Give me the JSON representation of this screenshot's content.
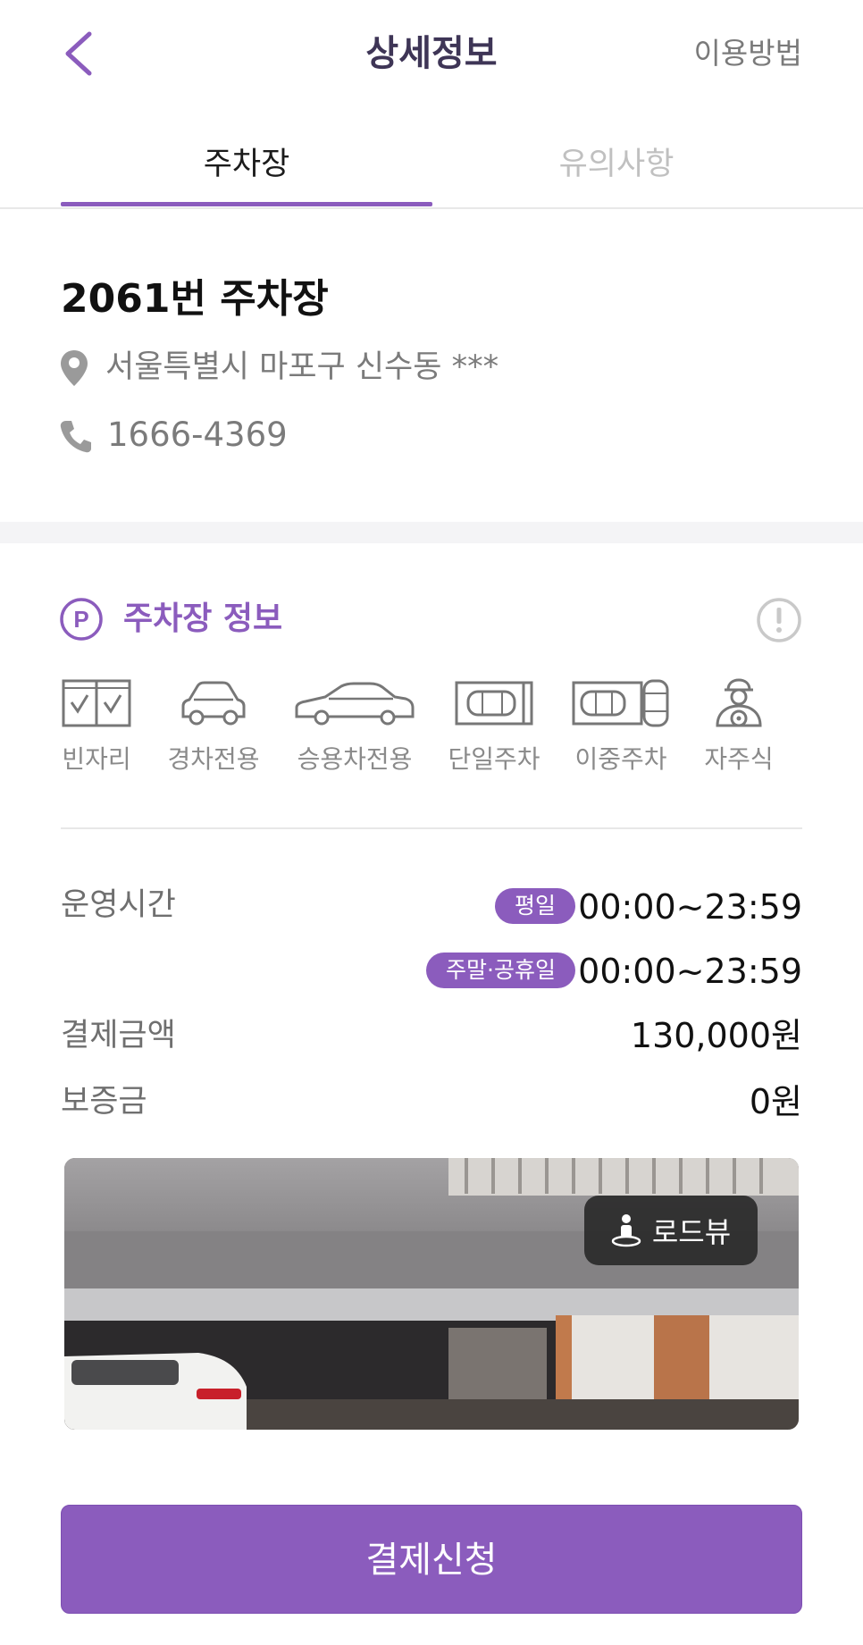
{
  "header": {
    "title": "상세정보",
    "help_label": "이용방법"
  },
  "tabs": [
    {
      "label": "주차장",
      "active": true
    },
    {
      "label": "유의사항",
      "active": false
    }
  ],
  "lot": {
    "name": "2061번 주차장",
    "address": "서울특별시 마포구 신수동 ***",
    "phone": "1666-4369"
  },
  "info": {
    "title": "주차장 정보",
    "p_badge": "P",
    "features": [
      {
        "label": "빈자리",
        "icon": "empty-slots-icon"
      },
      {
        "label": "경차전용",
        "icon": "compact-car-icon"
      },
      {
        "label": "승용차전용",
        "icon": "sedan-icon"
      },
      {
        "label": "단일주차",
        "icon": "single-parking-icon"
      },
      {
        "label": "이중주차",
        "icon": "double-parking-icon"
      },
      {
        "label": "자주식",
        "icon": "self-parking-driver-icon"
      }
    ],
    "hours_label": "운영시간",
    "weekday_badge": "평일",
    "weekday_hours": "00:00~23:59",
    "weekend_badge": "주말·공휴일",
    "weekend_hours": "00:00~23:59",
    "payment_label": "결제금액",
    "payment_value": "130,000원",
    "deposit_label": "보증금",
    "deposit_value": "0원"
  },
  "roadview_label": "로드뷰",
  "pay_button": "결제신청",
  "colors": {
    "accent": "#8b5cbd",
    "title": "#3e3556",
    "muted": "#7b7b7b"
  }
}
